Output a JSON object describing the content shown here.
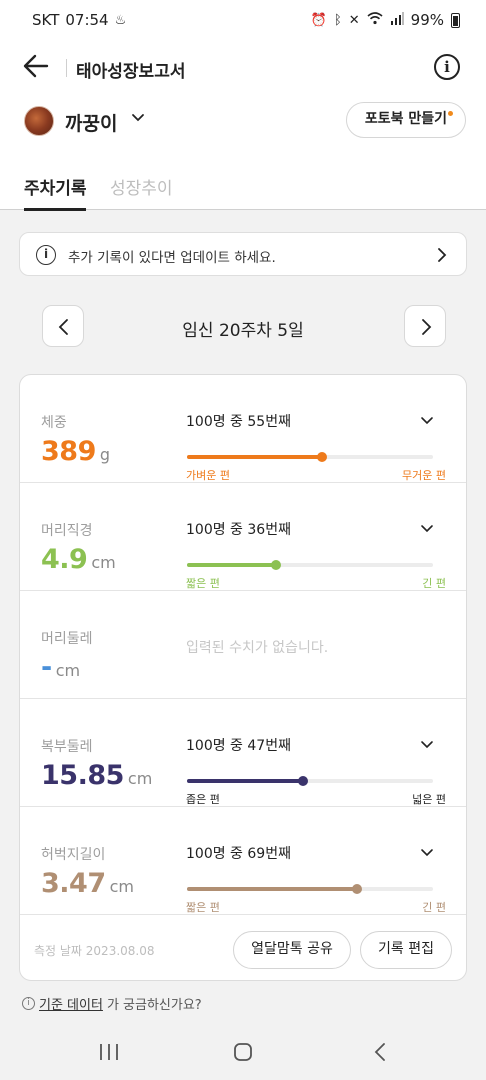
{
  "status_bar": {
    "carrier": "SKT",
    "time": "07:54",
    "battery": "99%"
  },
  "app_bar": {
    "title": "태아성장보고서"
  },
  "baby": {
    "name": "까꿍이",
    "photobook_label": "포토북 만들기"
  },
  "tabs": [
    {
      "label": "주차기록",
      "active": true
    },
    {
      "label": "성장추이",
      "active": false
    }
  ],
  "notice": {
    "text": "추가 기록이 있다면 업데이트 하세요."
  },
  "week": {
    "label": "임신 20주차 5일"
  },
  "metrics": [
    {
      "label": "체중",
      "value": "389",
      "unit": "g",
      "rank": "100명 중 55번째",
      "percentile": 55,
      "low_label": "가벼운 편",
      "high_label": "무거운 편",
      "color": "#ee7a1b"
    },
    {
      "label": "머리직경",
      "value": "4.9",
      "unit": "cm",
      "rank": "100명 중 36번째",
      "percentile": 36,
      "low_label": "짧은 편",
      "high_label": "긴 편",
      "color": "#8cc152"
    },
    {
      "label": "머리둘레",
      "value": "-",
      "unit": "cm",
      "empty_message": "입력된 수치가 없습니다.",
      "color": "#4a90d9"
    },
    {
      "label": "복부둘레",
      "value": "15.85",
      "unit": "cm",
      "rank": "100명 중 47번째",
      "percentile": 47,
      "low_label": "좁은 편",
      "high_label": "넓은 편",
      "color": "#3a336b"
    },
    {
      "label": "허벅지길이",
      "value": "3.47",
      "unit": "cm",
      "rank": "100명 중 69번째",
      "percentile": 69,
      "low_label": "짧은 편",
      "high_label": "긴 편",
      "color": "#b08f73"
    }
  ],
  "footer": {
    "measure_date": "측정 날짜 2023.08.08",
    "share_label": "열달맘톡 공유",
    "edit_label": "기록 편집"
  },
  "help": {
    "link_text": "기준 데이터",
    "suffix_text": "가 궁금하신가요?"
  }
}
